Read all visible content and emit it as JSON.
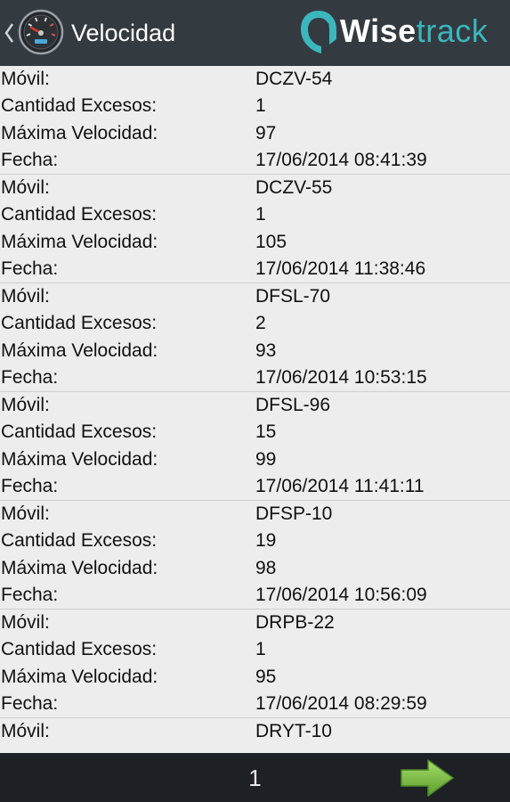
{
  "header": {
    "title": "Velocidad",
    "back_icon": "chevron-left-icon",
    "app_icon": "speedometer-icon",
    "logo_part1": "Wise",
    "logo_part2": "track"
  },
  "labels": {
    "movil": "Móvil:",
    "excesos": "Cantidad Excesos:",
    "velocidad": "Máxima Velocidad:",
    "fecha": "Fecha:"
  },
  "records": [
    {
      "movil": "DCZV-54",
      "excesos": "1",
      "velocidad": "97",
      "fecha": "17/06/2014 08:41:39"
    },
    {
      "movil": "DCZV-55",
      "excesos": "1",
      "velocidad": "105",
      "fecha": "17/06/2014 11:38:46"
    },
    {
      "movil": "DFSL-70",
      "excesos": "2",
      "velocidad": "93",
      "fecha": "17/06/2014 10:53:15"
    },
    {
      "movil": "DFSL-96",
      "excesos": "15",
      "velocidad": "99",
      "fecha": "17/06/2014 11:41:11"
    },
    {
      "movil": "DFSP-10",
      "excesos": "19",
      "velocidad": "98",
      "fecha": "17/06/2014 10:56:09"
    },
    {
      "movil": "DRPB-22",
      "excesos": "1",
      "velocidad": "95",
      "fecha": "17/06/2014 08:29:59"
    },
    {
      "movil": "DRYT-10"
    }
  ],
  "footer": {
    "page": "1",
    "next_icon": "arrow-right-icon"
  },
  "colors": {
    "header_bg": "#333a40",
    "logo_accent": "#3bb6bd",
    "arrow": "#7cc142",
    "footer_bg": "#1d2125"
  }
}
